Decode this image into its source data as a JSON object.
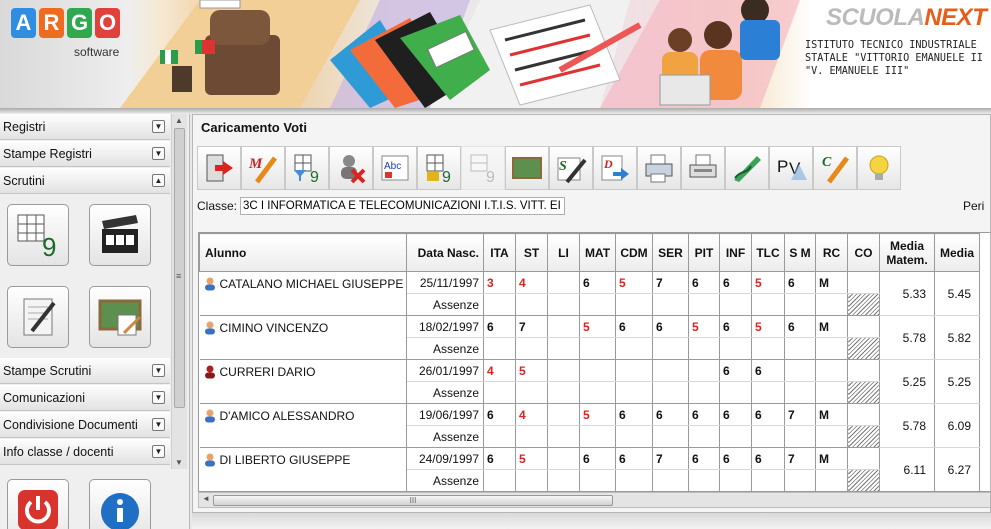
{
  "logo": {
    "letters": [
      "A",
      "R",
      "G",
      "O"
    ],
    "colors": [
      "#2f8ee0",
      "#ef6b1d",
      "#2fa84f",
      "#e0413a"
    ],
    "sub": "software"
  },
  "school": {
    "brand_a": "SCUOLA",
    "brand_b": "NEXT",
    "lines": [
      "ISTITUTO TECNICO INDUSTRIALE",
      "STATALE \"VITTORIO EMANUELE II",
      "\"V. EMANUELE III\""
    ]
  },
  "sidebar": {
    "sections_top": [
      {
        "label": "Registri",
        "arrow": "▼"
      },
      {
        "label": "Stampe Registri",
        "arrow": "▼"
      },
      {
        "label": "Scrutini",
        "arrow": "▲"
      }
    ],
    "sections_bottom": [
      {
        "label": "Stampe Scrutini",
        "arrow": "▼"
      },
      {
        "label": "Comunicazioni",
        "arrow": "▼"
      },
      {
        "label": "Condivisione Documenti",
        "arrow": "▼"
      },
      {
        "label": "Info classe / docenti",
        "arrow": "▼"
      }
    ],
    "scroll_mark": "≡"
  },
  "main": {
    "title": "Caricamento Voti",
    "class_label": "Classe:",
    "class_value": "3C I INFORMATICA E TELECOMUNICAZIONI I.T.I.S. VITT. EI",
    "peri_label": "Peri"
  },
  "toolbar_icons": [
    "exit-icon",
    "m-pencil-icon",
    "calculator-filter-icon",
    "user-remove-icon",
    "spellcheck-icon",
    "calculator-lock-icon",
    "calculator-disabled-icon",
    "blackboard-icon",
    "s-pencil-icon",
    "d-document-icon",
    "printer-icon",
    "fax-icon",
    "signature-icon",
    "pv-icon",
    "c-pencil-icon",
    "lightbulb-icon"
  ],
  "grid": {
    "headers": [
      "Alunno",
      "Data Nasc.",
      "ITA",
      "ST",
      "LI",
      "MAT",
      "CDM",
      "SER",
      "PIT",
      "INF",
      "TLC",
      "S M",
      "RC",
      "CO",
      "Media Matem.",
      "Media"
    ],
    "assenze_label": "Assenze",
    "students": [
      {
        "name": "CATALANO MICHAEL GIUSEPPE",
        "dob": "25/11/1997",
        "icon": "student-icon",
        "grades": [
          "3",
          "4",
          "",
          "6",
          "5",
          "7",
          "6",
          "6",
          "5",
          "6",
          "M"
        ],
        "neg": [
          true,
          true,
          false,
          false,
          true,
          false,
          false,
          false,
          true,
          false,
          false
        ],
        "media_matem": "5.33",
        "media": "5.45"
      },
      {
        "name": "CIMINO VINCENZO",
        "dob": "18/02/1997",
        "icon": "student-icon",
        "grades": [
          "6",
          "7",
          "",
          "5",
          "6",
          "6",
          "5",
          "6",
          "5",
          "6",
          "M"
        ],
        "neg": [
          false,
          false,
          false,
          true,
          false,
          false,
          true,
          false,
          true,
          false,
          false
        ],
        "media_matem": "5.78",
        "media": "5.82"
      },
      {
        "name": "CURRERI DARIO",
        "dob": "26/01/1997",
        "icon": "student-red-icon",
        "grades": [
          "4",
          "5",
          "",
          "",
          "",
          "",
          "",
          "6",
          "6",
          "",
          ""
        ],
        "neg": [
          true,
          true,
          false,
          false,
          false,
          false,
          false,
          false,
          false,
          false,
          false
        ],
        "media_matem": "5.25",
        "media": "5.25"
      },
      {
        "name": "D'AMICO ALESSANDRO",
        "dob": "19/06/1997",
        "icon": "student-icon",
        "grades": [
          "6",
          "4",
          "",
          "5",
          "6",
          "6",
          "6",
          "6",
          "6",
          "7",
          "M"
        ],
        "neg": [
          false,
          true,
          false,
          true,
          false,
          false,
          false,
          false,
          false,
          false,
          false
        ],
        "media_matem": "5.78",
        "media": "6.09"
      },
      {
        "name": "DI LIBERTO GIUSEPPE",
        "dob": "24/09/1997",
        "icon": "student-icon",
        "grades": [
          "6",
          "5",
          "",
          "6",
          "6",
          "7",
          "6",
          "6",
          "6",
          "7",
          "M"
        ],
        "neg": [
          false,
          true,
          false,
          false,
          false,
          false,
          false,
          false,
          false,
          false,
          false
        ],
        "media_matem": "6.11",
        "media": "6.27"
      }
    ]
  },
  "hscroll_grip": "III"
}
